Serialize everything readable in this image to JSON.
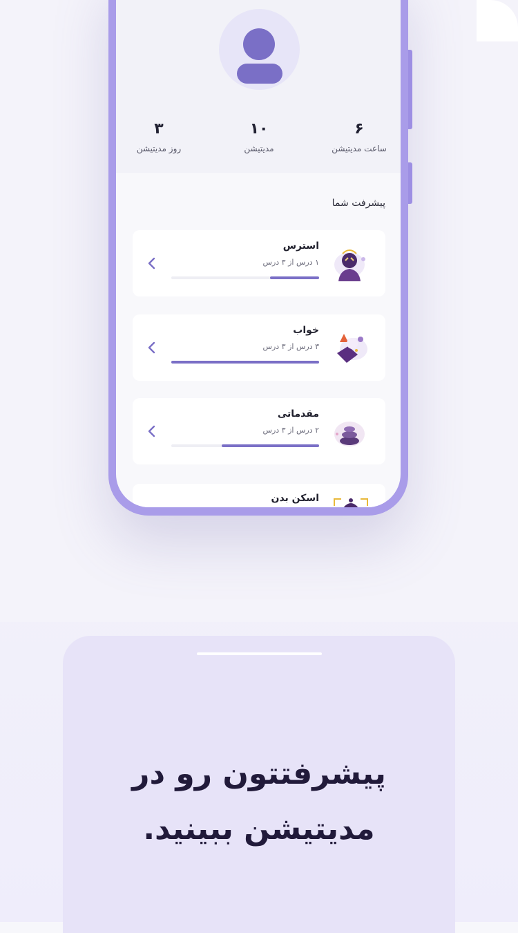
{
  "stats": [
    {
      "value": "۶",
      "label": "ساعت مدیتیشن"
    },
    {
      "value": "۱۰",
      "label": "مدیتیشن"
    },
    {
      "value": "۳",
      "label": "روز مدیتیشن"
    }
  ],
  "section_title": "پیشرفت شما",
  "courses": [
    {
      "title": "استرس",
      "subtitle": "۱ درس از ۳ درس",
      "progress": 0.33,
      "icon": "stress-illustration-icon"
    },
    {
      "title": "خواب",
      "subtitle": "۳ درس از ۳ درس",
      "progress": 1.0,
      "icon": "sleep-illustration-icon"
    },
    {
      "title": "مقدماتی",
      "subtitle": "۲ درس از ۳ درس",
      "progress": 0.66,
      "icon": "stones-illustration-icon"
    },
    {
      "title": "اسکن بدن",
      "subtitle": "",
      "progress": 0,
      "icon": "body-scan-illustration-icon"
    }
  ],
  "headline": "پیشرفتتون رو در مدیتیشن ببینید.",
  "colors": {
    "accent": "#7a6fc6",
    "phone_frame": "#a99ce9",
    "sheet": "#e7e3f8"
  }
}
